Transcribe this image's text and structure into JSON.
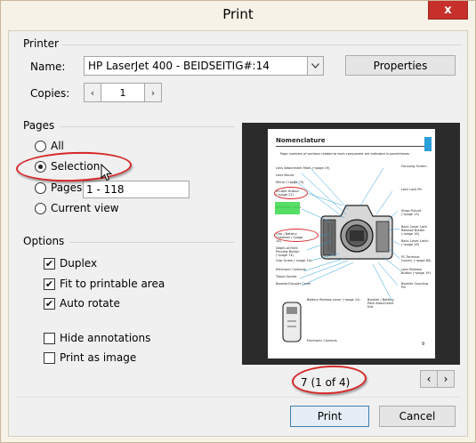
{
  "window": {
    "title": "Print",
    "close_symbol": "x"
  },
  "printer": {
    "group_label": "Printer",
    "name_label": "Name:",
    "name_value": "HP LaserJet 400 - BEIDSEITIG#:14",
    "properties_label": "Properties",
    "copies_label": "Copies:",
    "copies_value": "1",
    "decrement_symbol": "‹",
    "increment_symbol": "›"
  },
  "pages": {
    "group_label": "Pages",
    "options": [
      {
        "label": "All",
        "checked": false
      },
      {
        "label": "Selection",
        "checked": true
      },
      {
        "label": "Pages",
        "checked": false
      },
      {
        "label": "Current view",
        "checked": false
      }
    ],
    "range_value": "1 - 118"
  },
  "options": {
    "group_label": "Options",
    "items": [
      {
        "label": "Duplex",
        "checked": true
      },
      {
        "label": "Fit to printable area",
        "checked": true
      },
      {
        "label": "Auto rotate",
        "checked": true
      },
      {
        "label": "Hide annotations",
        "checked": false
      },
      {
        "label": "Print as image",
        "checked": false
      }
    ]
  },
  "preview": {
    "page_title": "Nomenclature",
    "bullet_text": "Page numbers of sections related to each component are indicated in parentheses.",
    "page_counter": "7 (1 of 4)",
    "prev_symbol": "‹",
    "next_symbol": "›",
    "page_number": "9",
    "labels_left": [
      "Lens Attachment Mark (→page 19)",
      "Lens Mount",
      "Mirror (→page 73)",
      "Shutter Button (→page 22)",
      "Self-timer Lamp",
      "Grip / Battery Chamber (→page 14)",
      "Depth-of-Field Preview Button (→page 74)",
      "Grip Screw (→page 14)",
      "Electronic Contacts",
      "Tripod Socket",
      "Booster/Coupler Cover",
      "Battery Release Lever (→page 14)",
      "Electronic Contacts"
    ],
    "labels_right": [
      "Focusing Screen",
      "Lens Lock Pin",
      "Strap Fixture (→page 13)",
      "Back Cover Lock Release Button (→page 16)",
      "Back Cover Latch (→page 16)",
      "PC Terminal (cover) (→page 80)",
      "Lens Release Button (→page 19)",
      "Booster Coupling Pin",
      "Booster / Battery Pack Attachment Nut"
    ]
  },
  "actions": {
    "print_label": "Print",
    "cancel_label": "Cancel"
  },
  "colors": {
    "annotation_red": "#d62828",
    "callout_blue": "#2a9fd8",
    "highlight_green": "#39d84a"
  }
}
